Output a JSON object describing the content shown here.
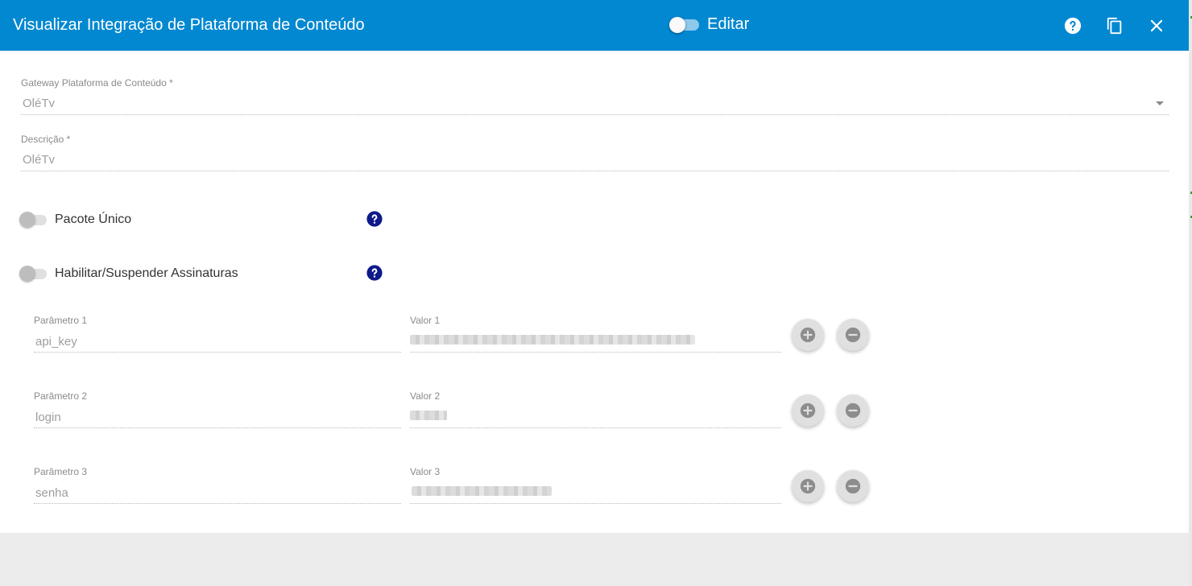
{
  "toolbar": {
    "title": "Visualizar Integração de Plataforma de Conteúdo",
    "edit_label": "Editar",
    "background": "#0288d1"
  },
  "form": {
    "gateway": {
      "label": "Gateway Plataforma de Conteúdo *",
      "value": "OléTv"
    },
    "descricao": {
      "label": "Descrição *",
      "value": "OléTv"
    },
    "pacote_unico": {
      "label": "Pacote Único",
      "checked": false
    },
    "habilitar": {
      "label": "Habilitar/Suspender Assinaturas",
      "checked": false
    },
    "parameters": [
      {
        "param_label": "Parâmetro 1",
        "param_value": "api_key",
        "valor_label": "Valor 1",
        "valor_value": ""
      },
      {
        "param_label": "Parâmetro 2",
        "param_value": "login",
        "valor_label": "Valor 2",
        "valor_value": ""
      },
      {
        "param_label": "Parâmetro 3",
        "param_value": "senha",
        "valor_label": "Valor 3",
        "valor_value": ""
      }
    ]
  },
  "icons": {
    "help": "help-circle-icon",
    "copy": "copy-icon",
    "close": "close-icon",
    "add": "plus-circle-icon",
    "remove": "minus-circle-icon",
    "dropdown": "dropdown-arrow-icon"
  },
  "colors": {
    "accent": "#0288d1",
    "help_icon": "#0d1a8a",
    "fab": "#e0e0e0"
  }
}
